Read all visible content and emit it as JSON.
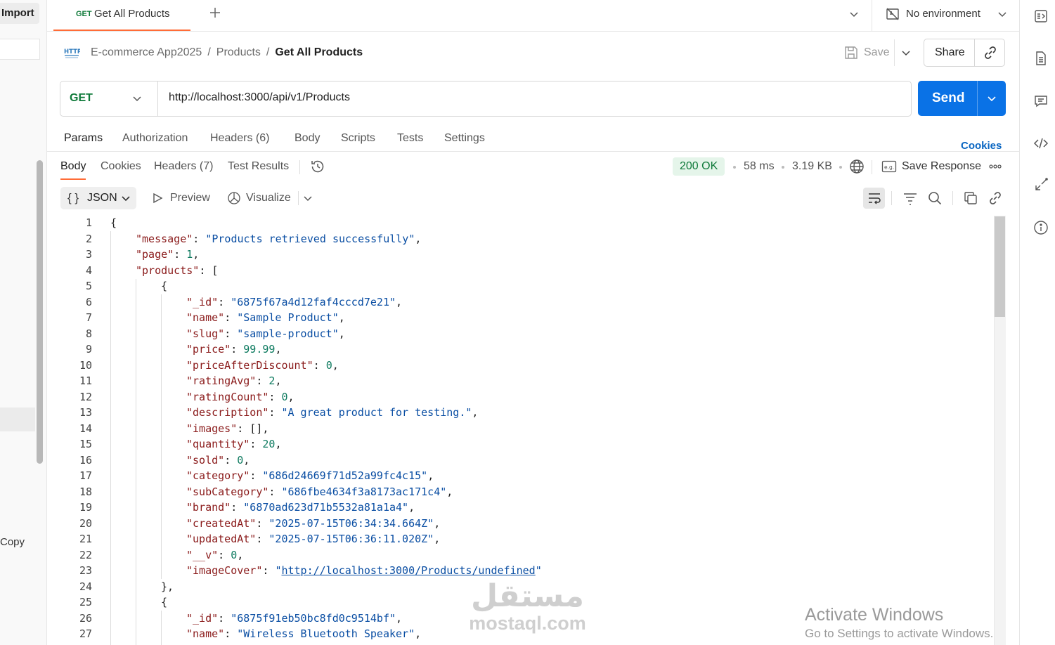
{
  "left_sidebar": {
    "import_label": "Import",
    "copy_label": "Copy"
  },
  "tabs": {
    "active": {
      "method": "GET",
      "title": "Get All Products"
    },
    "environment": "No environment"
  },
  "breadcrumb": {
    "collection": "E-commerce App2025",
    "folder": "Products",
    "current": "Get All Products",
    "icon": "http-icon"
  },
  "header_actions": {
    "save_label": "Save",
    "share_label": "Share"
  },
  "request": {
    "method": "GET",
    "url": "http://localhost:3000/api/v1/Products",
    "send_label": "Send",
    "tabs": [
      "Params",
      "Authorization",
      "Headers (6)",
      "Body",
      "Scripts",
      "Tests",
      "Settings"
    ],
    "cookies_label": "Cookies"
  },
  "response": {
    "tabs": [
      "Body",
      "Cookies",
      "Headers (7)",
      "Test Results"
    ],
    "status": "200 OK",
    "time": "58 ms",
    "size": "3.19 KB",
    "save_response_label": "Save Response",
    "format_label": "JSON",
    "format_braces": "{ }",
    "preview_label": "Preview",
    "visualize_label": "Visualize"
  },
  "code": {
    "line_numbers": [
      "1",
      "2",
      "3",
      "4",
      "5",
      "6",
      "7",
      "8",
      "9",
      "10",
      "11",
      "12",
      "13",
      "14",
      "15",
      "16",
      "17",
      "18",
      "19",
      "20",
      "21",
      "22",
      "23",
      "24",
      "25",
      "26",
      "27"
    ],
    "lines": [
      {
        "indent": 0,
        "parts": [
          [
            "p",
            "{"
          ]
        ]
      },
      {
        "indent": 1,
        "parts": [
          [
            "k",
            "\"message\""
          ],
          [
            "p",
            ": "
          ],
          [
            "s",
            "\"Products retrieved successfully\""
          ],
          [
            "p",
            ","
          ]
        ]
      },
      {
        "indent": 1,
        "parts": [
          [
            "k",
            "\"page\""
          ],
          [
            "p",
            ": "
          ],
          [
            "n",
            "1"
          ],
          [
            "p",
            ","
          ]
        ]
      },
      {
        "indent": 1,
        "parts": [
          [
            "k",
            "\"products\""
          ],
          [
            "p",
            ": ["
          ]
        ]
      },
      {
        "indent": 2,
        "parts": [
          [
            "p",
            "{"
          ]
        ]
      },
      {
        "indent": 3,
        "parts": [
          [
            "k",
            "\"_id\""
          ],
          [
            "p",
            ": "
          ],
          [
            "s",
            "\"6875f67a4d12faf4cccd7e21\""
          ],
          [
            "p",
            ","
          ]
        ]
      },
      {
        "indent": 3,
        "parts": [
          [
            "k",
            "\"name\""
          ],
          [
            "p",
            ": "
          ],
          [
            "s",
            "\"Sample Product\""
          ],
          [
            "p",
            ","
          ]
        ]
      },
      {
        "indent": 3,
        "parts": [
          [
            "k",
            "\"slug\""
          ],
          [
            "p",
            ": "
          ],
          [
            "s",
            "\"sample-product\""
          ],
          [
            "p",
            ","
          ]
        ]
      },
      {
        "indent": 3,
        "parts": [
          [
            "k",
            "\"price\""
          ],
          [
            "p",
            ": "
          ],
          [
            "n",
            "99.99"
          ],
          [
            "p",
            ","
          ]
        ]
      },
      {
        "indent": 3,
        "parts": [
          [
            "k",
            "\"priceAfterDiscount\""
          ],
          [
            "p",
            ": "
          ],
          [
            "n",
            "0"
          ],
          [
            "p",
            ","
          ]
        ]
      },
      {
        "indent": 3,
        "parts": [
          [
            "k",
            "\"ratingAvg\""
          ],
          [
            "p",
            ": "
          ],
          [
            "n",
            "2"
          ],
          [
            "p",
            ","
          ]
        ]
      },
      {
        "indent": 3,
        "parts": [
          [
            "k",
            "\"ratingCount\""
          ],
          [
            "p",
            ": "
          ],
          [
            "n",
            "0"
          ],
          [
            "p",
            ","
          ]
        ]
      },
      {
        "indent": 3,
        "parts": [
          [
            "k",
            "\"description\""
          ],
          [
            "p",
            ": "
          ],
          [
            "s",
            "\"A great product for testing.\""
          ],
          [
            "p",
            ","
          ]
        ]
      },
      {
        "indent": 3,
        "parts": [
          [
            "k",
            "\"images\""
          ],
          [
            "p",
            ": [],"
          ]
        ]
      },
      {
        "indent": 3,
        "parts": [
          [
            "k",
            "\"quantity\""
          ],
          [
            "p",
            ": "
          ],
          [
            "n",
            "20"
          ],
          [
            "p",
            ","
          ]
        ]
      },
      {
        "indent": 3,
        "parts": [
          [
            "k",
            "\"sold\""
          ],
          [
            "p",
            ": "
          ],
          [
            "n",
            "0"
          ],
          [
            "p",
            ","
          ]
        ]
      },
      {
        "indent": 3,
        "parts": [
          [
            "k",
            "\"category\""
          ],
          [
            "p",
            ": "
          ],
          [
            "s",
            "\"686d24669f71d52a99fc4c15\""
          ],
          [
            "p",
            ","
          ]
        ]
      },
      {
        "indent": 3,
        "parts": [
          [
            "k",
            "\"subCategory\""
          ],
          [
            "p",
            ": "
          ],
          [
            "s",
            "\"686fbe4634f3a8173ac171c4\""
          ],
          [
            "p",
            ","
          ]
        ]
      },
      {
        "indent": 3,
        "parts": [
          [
            "k",
            "\"brand\""
          ],
          [
            "p",
            ": "
          ],
          [
            "s",
            "\"6870ad623d71b5532a81a1a4\""
          ],
          [
            "p",
            ","
          ]
        ]
      },
      {
        "indent": 3,
        "parts": [
          [
            "k",
            "\"createdAt\""
          ],
          [
            "p",
            ": "
          ],
          [
            "s",
            "\"2025-07-15T06:34:34.664Z\""
          ],
          [
            "p",
            ","
          ]
        ]
      },
      {
        "indent": 3,
        "parts": [
          [
            "k",
            "\"updatedAt\""
          ],
          [
            "p",
            ": "
          ],
          [
            "s",
            "\"2025-07-15T06:36:11.020Z\""
          ],
          [
            "p",
            ","
          ]
        ]
      },
      {
        "indent": 3,
        "parts": [
          [
            "k",
            "\"__v\""
          ],
          [
            "p",
            ": "
          ],
          [
            "n",
            "0"
          ],
          [
            "p",
            ","
          ]
        ]
      },
      {
        "indent": 3,
        "parts": [
          [
            "k",
            "\"imageCover\""
          ],
          [
            "p",
            ": "
          ],
          [
            "s",
            "\""
          ],
          [
            "u",
            "http://localhost:3000/Products/undefined"
          ],
          [
            "s",
            "\""
          ]
        ]
      },
      {
        "indent": 2,
        "parts": [
          [
            "p",
            "},"
          ]
        ]
      },
      {
        "indent": 2,
        "parts": [
          [
            "p",
            "{"
          ]
        ]
      },
      {
        "indent": 3,
        "parts": [
          [
            "k",
            "\"_id\""
          ],
          [
            "p",
            ": "
          ],
          [
            "s",
            "\"6875f91eb50bc8fd0c9514bf\""
          ],
          [
            "p",
            ","
          ]
        ]
      },
      {
        "indent": 3,
        "parts": [
          [
            "k",
            "\"name\""
          ],
          [
            "p",
            ": "
          ],
          [
            "s",
            "\"Wireless Bluetooth Speaker\""
          ],
          [
            "p",
            ","
          ]
        ]
      }
    ]
  },
  "overlays": {
    "watermark_arabic": "مستقل",
    "watermark_latin": "mostaql.com",
    "activate_title": "Activate Windows",
    "activate_subtitle": "Go to Settings to activate Windows."
  }
}
